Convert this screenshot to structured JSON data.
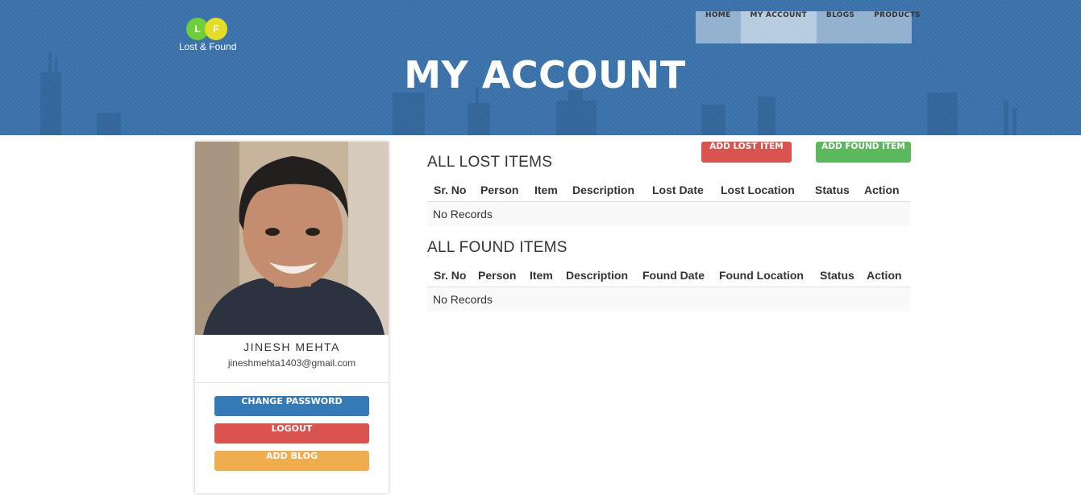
{
  "header": {
    "logo": {
      "letter1": "L",
      "letter2": "F",
      "text": "Lost & Found"
    },
    "nav": [
      {
        "label": "HOME"
      },
      {
        "label": "MY ACCOUNT"
      },
      {
        "label": "BLOGS"
      },
      {
        "label": "PRODUCTS"
      }
    ],
    "title": "MY ACCOUNT"
  },
  "profile": {
    "name": "JINESH MEHTA",
    "email": "jineshmehta1403@gmail.com",
    "buttons": {
      "change_password": "CHANGE PASSWORD",
      "logout": "LOGOUT",
      "add_blog": "ADD BLOG"
    }
  },
  "actions": {
    "add_lost": "ADD LOST ITEM",
    "add_found": "ADD FOUND ITEM"
  },
  "lost": {
    "title": "ALL LOST ITEMS",
    "columns": [
      "Sr. No",
      "Person",
      "Item",
      "Description",
      "Lost Date",
      "Lost Location",
      "Status",
      "Action"
    ],
    "empty": "No Records"
  },
  "found": {
    "title": "ALL FOUND ITEMS",
    "columns": [
      "Sr. No",
      "Person",
      "Item",
      "Description",
      "Found Date",
      "Found Location",
      "Status",
      "Action"
    ],
    "empty": "No Records"
  },
  "colors": {
    "header_bg": "#3a73ab",
    "primary": "#337ab7",
    "danger": "#d9534f",
    "warning": "#f0ad4e",
    "success": "#5cb85c"
  }
}
